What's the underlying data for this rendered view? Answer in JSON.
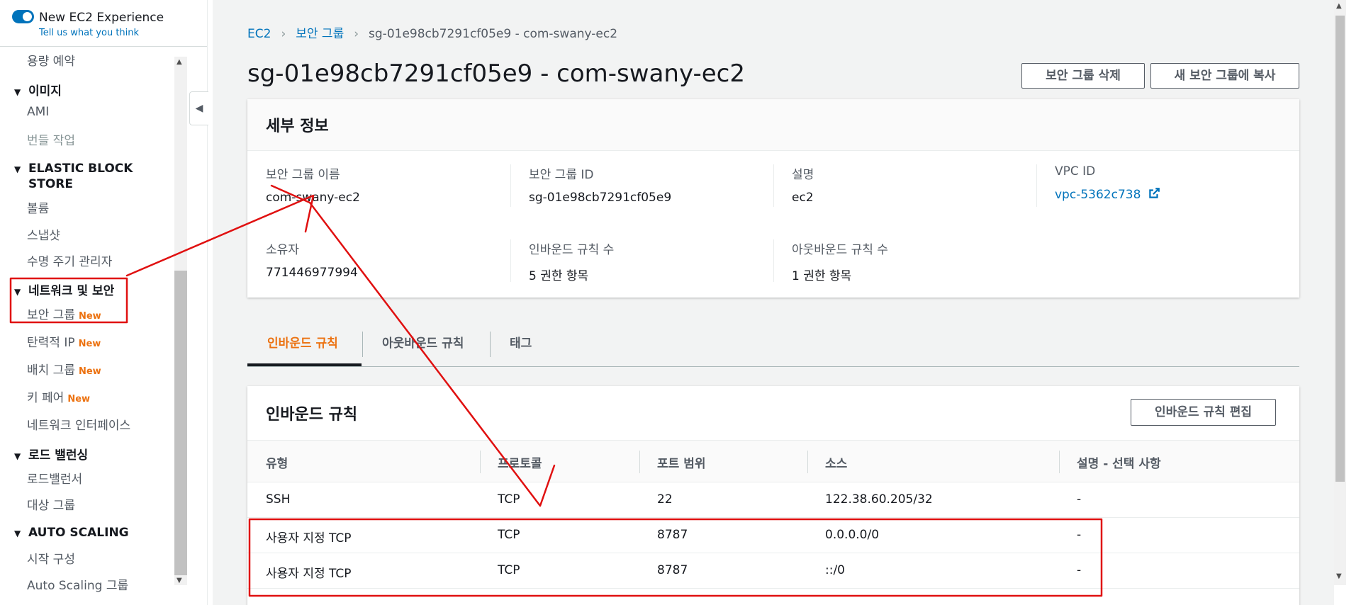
{
  "sidebar": {
    "new_experience": "New EC2 Experience",
    "feedback": "Tell us what you think",
    "top_item": "용량 예약",
    "images_section": "이미지",
    "images_items": [
      "AMI",
      "번들 작업"
    ],
    "ebs_section_line1": "ELASTIC BLOCK",
    "ebs_section_line2": "STORE",
    "ebs_items": [
      "볼륨",
      "스냅샷",
      "수명 주기 관리자"
    ],
    "network_section": "네트워크 및 보안",
    "network_items": [
      "보안 그룹",
      "탄력적 IP",
      "배치 그룹",
      "키 페어",
      "네트워크 인터페이스"
    ],
    "new_badge": "New",
    "lb_section": "로드 밸런싱",
    "lb_items": [
      "로드밸런서",
      "대상 그룹"
    ],
    "as_section": "AUTO SCALING",
    "as_items": [
      "시작 구성",
      "Auto Scaling 그룹"
    ]
  },
  "breadcrumb": {
    "ec2": "EC2",
    "sg": "보안 그룹",
    "current": "sg-01e98cb7291cf05e9 - com-swany-ec2"
  },
  "page_title": "sg-01e98cb7291cf05e9 - com-swany-ec2",
  "actions": {
    "delete": "보안 그룹 삭제",
    "copy": "새 보안 그룹에 복사"
  },
  "details": {
    "title": "세부 정보",
    "name_label": "보안 그룹 이름",
    "name_value": "com-swany-ec2",
    "id_label": "보안 그룹 ID",
    "id_value": "sg-01e98cb7291cf05e9",
    "desc_label": "설명",
    "desc_value": "ec2",
    "vpc_label": "VPC ID",
    "vpc_value": "vpc-5362c738",
    "owner_label": "소유자",
    "owner_value": "771446977994",
    "inbound_count_label": "인바운드 규칙 수",
    "inbound_count_value": "5 권한 항목",
    "outbound_count_label": "아웃바운드 규칙 수",
    "outbound_count_value": "1 권한 항목"
  },
  "tabs": [
    "인바운드 규칙",
    "아웃바운드 규칙",
    "태그"
  ],
  "inbound": {
    "title": "인바운드 규칙",
    "edit_button": "인바운드 규칙 편집",
    "columns": [
      "유형",
      "프로토콜",
      "포트 범위",
      "소스",
      "설명 - 선택 사항"
    ],
    "rows": [
      [
        "SSH",
        "TCP",
        "22",
        "122.38.60.205/32",
        "-"
      ],
      [
        "사용자 지정 TCP",
        "TCP",
        "8787",
        "0.0.0.0/0",
        "-"
      ],
      [
        "사용자 지정 TCP",
        "TCP",
        "8787",
        "::/0",
        "-"
      ]
    ]
  },
  "colors": {
    "link": "#0073bb",
    "accent": "#ec7211",
    "annotation": "#e01010"
  }
}
